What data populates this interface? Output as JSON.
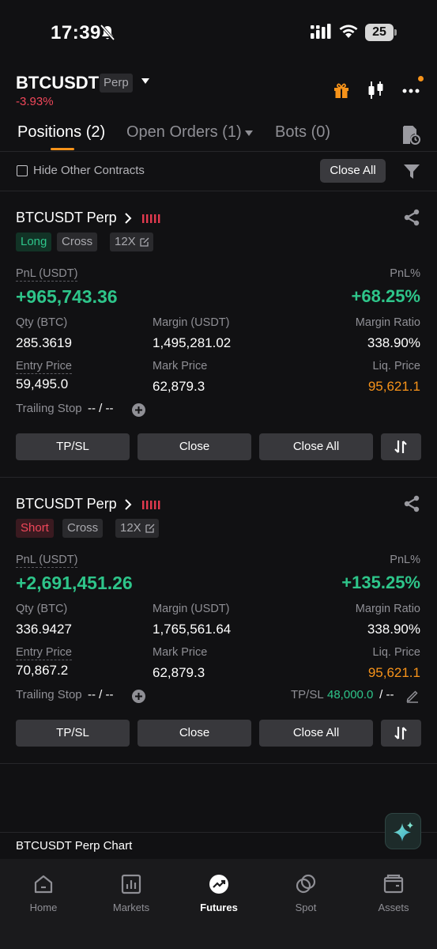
{
  "status_bar": {
    "time": "17:39",
    "battery": "25"
  },
  "header": {
    "symbol": "BTCUSDT",
    "contract_type": "Perp",
    "change": "-3.93%"
  },
  "tabs": [
    {
      "label": "Positions (2)",
      "active": true
    },
    {
      "label": "Open Orders (1)",
      "active": false
    },
    {
      "label": "Bots (0)",
      "active": false
    }
  ],
  "filter": {
    "hide_other_contracts": "Hide Other Contracts",
    "close_all": "Close All"
  },
  "labels": {
    "pnl": "PnL (USDT)",
    "pnl_pct": "PnL%",
    "qty": "Qty (BTC)",
    "margin": "Margin (USDT)",
    "margin_ratio": "Margin Ratio",
    "entry_price": "Entry Price",
    "mark_price": "Mark Price",
    "liq_price": "Liq. Price",
    "trailing_stop": "Trailing Stop",
    "tpsl": "TP/SL"
  },
  "buttons": {
    "tpsl": "TP/SL",
    "close": "Close",
    "close_all": "Close All"
  },
  "positions": [
    {
      "title": "BTCUSDT Perp",
      "side": "Long",
      "margin_mode": "Cross",
      "leverage": "12X",
      "pnl": "+965,743.36",
      "pnl_pct": "+68.25%",
      "qty": "285.3619",
      "margin": "1,495,281.02",
      "margin_ratio": "338.90%",
      "entry_price": "59,495.0",
      "mark_price": "62,879.3",
      "liq_price": "95,621.1",
      "trailing_stop": "-- / --"
    },
    {
      "title": "BTCUSDT Perp",
      "side": "Short",
      "margin_mode": "Cross",
      "leverage": "12X",
      "pnl": "+2,691,451.26",
      "pnl_pct": "+135.25%",
      "qty": "336.9427",
      "margin": "1,765,561.64",
      "margin_ratio": "338.90%",
      "entry_price": "70,867.2",
      "mark_price": "62,879.3",
      "liq_price": "95,621.1",
      "trailing_stop": "-- / --",
      "tpsl_tp": "48,000.0",
      "tpsl_sl": " / --"
    }
  ],
  "chart_bar": {
    "label": "BTCUSDT Perp Chart"
  },
  "nav": [
    {
      "label": "Home",
      "icon": "home-icon"
    },
    {
      "label": "Markets",
      "icon": "markets-icon"
    },
    {
      "label": "Futures",
      "icon": "futures-icon",
      "active": true
    },
    {
      "label": "Spot",
      "icon": "spot-icon"
    },
    {
      "label": "Assets",
      "icon": "assets-icon"
    }
  ],
  "colors": {
    "accent": "#f7931a",
    "positive": "#2ec58a",
    "negative": "#f0475a",
    "background": "#111113"
  }
}
